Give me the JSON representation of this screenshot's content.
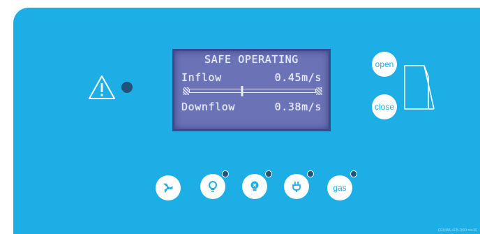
{
  "display": {
    "status": "SAFE OPERATING",
    "inflow_label": "Inflow",
    "inflow_value": "0.45m/s",
    "downflow_label": "Downflow",
    "downflow_value": "0.38m/s",
    "airflow_balance_fraction": 0.42
  },
  "sash_controls": {
    "open_label": "open",
    "close_label": "close"
  },
  "function_buttons": [
    {
      "icon": "fan-icon",
      "label": ""
    },
    {
      "icon": "light-bulb-icon",
      "label": ""
    },
    {
      "icon": "uv-lamp-icon",
      "label": ""
    },
    {
      "icon": "power-plug-icon",
      "label": ""
    },
    {
      "icon": "",
      "label": "gas"
    }
  ],
  "footer": {
    "code": "CRUMA-4FB-DI00 rev.00"
  },
  "colors": {
    "panel": "#1eaee6",
    "lcd_background": "#6b73b6",
    "lcd_text": "#e8ebfb",
    "indicator_led": "#22527a",
    "button": "#ffffff"
  }
}
